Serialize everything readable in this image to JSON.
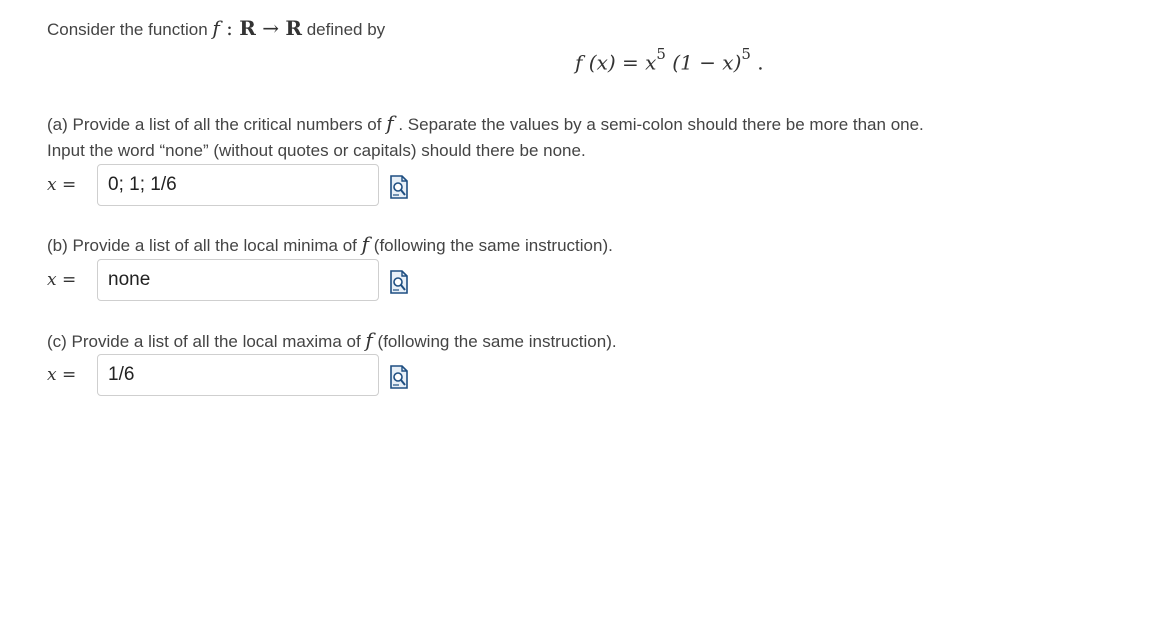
{
  "intro": {
    "prefix": "Consider the function",
    "f": "f",
    "colon": " : ",
    "R1": "R",
    "arrow": " → ",
    "R2": "R",
    "suffix": "defined by"
  },
  "equation": {
    "lhs": "f (x) = x",
    "exp1": "5",
    "mid": " (1 − x)",
    "exp2": "5",
    "end": " ."
  },
  "part_a": {
    "text_before": "(a) Provide a list of all the critical numbers of",
    "symbol": "f",
    "text_after": ". Separate the values by a semi-colon should there be more than one.",
    "line2": "Input the word “none” (without quotes or capitals) should there be none."
  },
  "part_b": {
    "text_before": "(b) Provide a list of all the local minima of",
    "symbol": "f",
    "text_after": "(following the same instruction)."
  },
  "part_c": {
    "text_before": "(c) Provide a list of all the local maxima of",
    "symbol": "f",
    "text_after": "(following the same instruction)."
  },
  "answers": {
    "label_var": "x",
    "label_eq": " =",
    "a_value": "0; 1; 1/6",
    "b_value": "none",
    "c_value": "1/6"
  },
  "icons": {
    "preview": "preview-magnifier-icon"
  }
}
